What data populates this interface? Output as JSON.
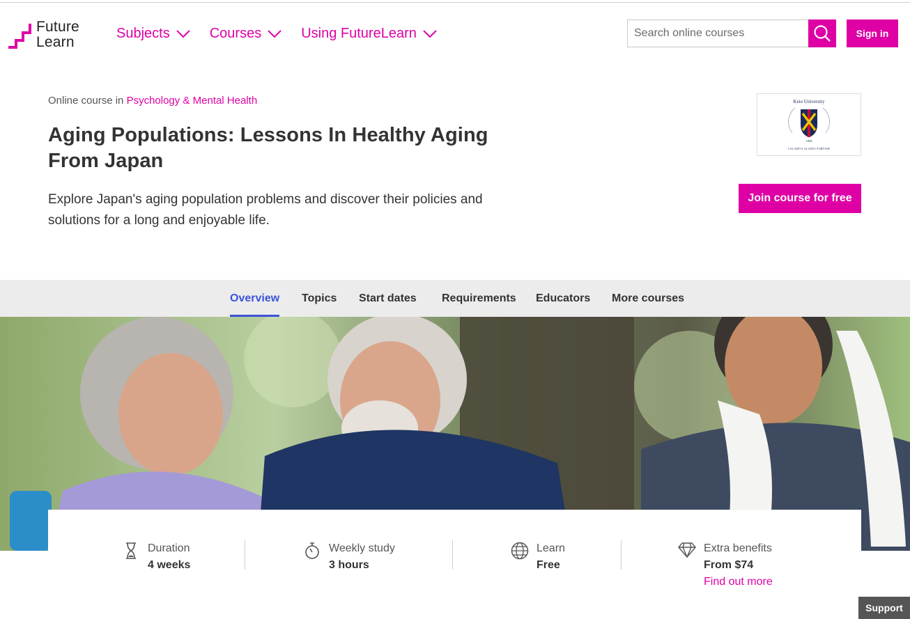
{
  "brand": {
    "name_line1": "Future",
    "name_line2": "Learn",
    "accent": "#de00a5",
    "tab_active": "#3c53d8"
  },
  "nav": [
    {
      "label": "Subjects"
    },
    {
      "label": "Courses"
    },
    {
      "label": "Using FutureLearn"
    }
  ],
  "search": {
    "placeholder": "Search online courses",
    "icon": "search-icon"
  },
  "signin_label": "Sign in",
  "breadcrumb": {
    "prefix": "Online course in ",
    "category": "Psychology & Mental Health"
  },
  "course": {
    "title": "Aging Populations: Lessons In Healthy Aging From Japan",
    "description": "Explore Japan's aging population problems and discover their policies and solutions for a long and enjoyable life.",
    "join_label": "Join course for free",
    "university_logo": {
      "name": "Keio University",
      "year": "1858",
      "motto": "CALAMVS GLADIO FORTIOR"
    }
  },
  "tabs": [
    {
      "label": "Overview",
      "active": true
    },
    {
      "label": "Topics"
    },
    {
      "label": "Start dates"
    },
    {
      "label": "Requirements"
    },
    {
      "label": "Educators"
    },
    {
      "label": "More courses"
    }
  ],
  "info": {
    "duration": {
      "label": "Duration",
      "value": "4 weeks",
      "icon": "hourglass-icon"
    },
    "weekly": {
      "label": "Weekly study",
      "value": "3 hours",
      "icon": "stopwatch-icon"
    },
    "learn": {
      "label": "Learn",
      "value": "Free",
      "icon": "globe-icon"
    },
    "extra": {
      "label": "Extra benefits",
      "value": "From $74",
      "link": "Find out more",
      "icon": "diamond-icon"
    }
  },
  "support_label": "Support"
}
